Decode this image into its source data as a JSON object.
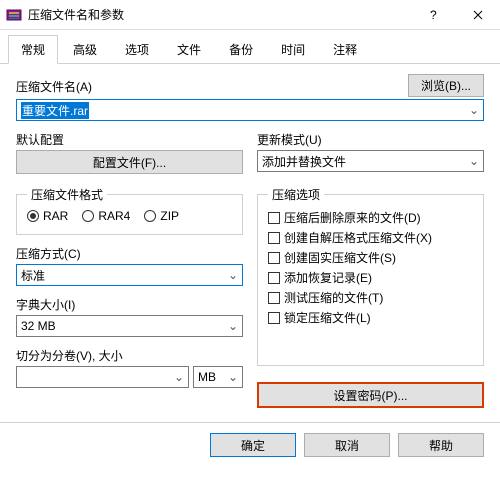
{
  "window": {
    "title": "压缩文件名和参数"
  },
  "tabs": [
    "常规",
    "高级",
    "选项",
    "文件",
    "备份",
    "时间",
    "注释"
  ],
  "active_tab": 0,
  "filename": {
    "label": "压缩文件名(A)",
    "value": "重要文件.rar",
    "browse": "浏览(B)..."
  },
  "default_profile": {
    "label": "默认配置",
    "button": "配置文件(F)..."
  },
  "update_mode": {
    "label": "更新模式(U)",
    "value": "添加并替换文件"
  },
  "format": {
    "legend": "压缩文件格式",
    "options": [
      "RAR",
      "RAR4",
      "ZIP"
    ],
    "selected": 0
  },
  "method": {
    "label": "压缩方式(C)",
    "value": "标准"
  },
  "dict": {
    "label": "字典大小(I)",
    "value": "32 MB"
  },
  "split": {
    "label": "切分为分卷(V), 大小",
    "value": "",
    "unit": "MB"
  },
  "options": {
    "legend": "压缩选项",
    "items": [
      "压缩后删除原来的文件(D)",
      "创建自解压格式压缩文件(X)",
      "创建固实压缩文件(S)",
      "添加恢复记录(E)",
      "测试压缩的文件(T)",
      "锁定压缩文件(L)"
    ]
  },
  "password_btn": "设置密码(P)...",
  "footer": {
    "ok": "确定",
    "cancel": "取消",
    "help": "帮助"
  }
}
